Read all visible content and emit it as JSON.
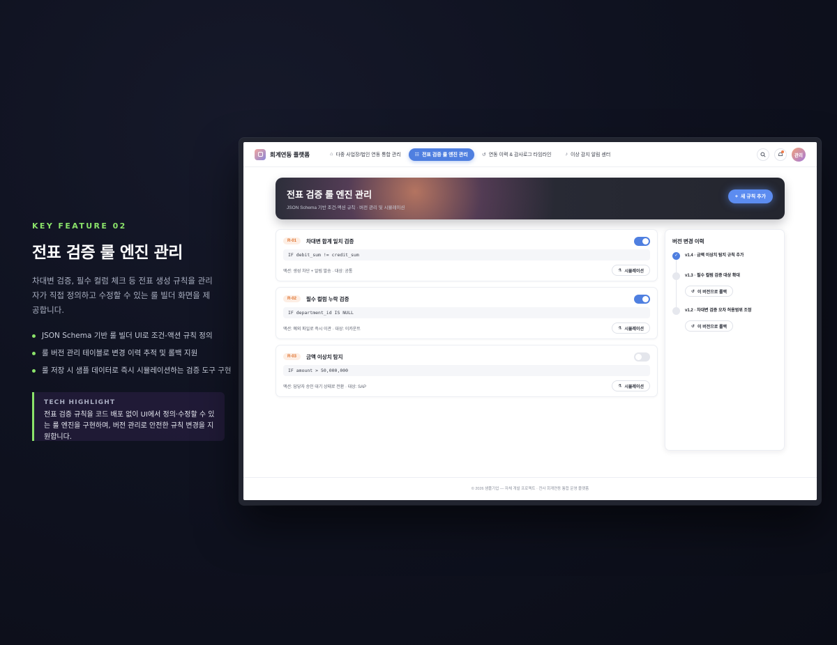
{
  "feature": {
    "kicker": "KEY FEATURE 02",
    "title": "전표 검증 룰 엔진 관리",
    "description": "차대변 검증, 필수 컬럼 체크 등 전표 생성 규칙을 관리자가 직접 정의하고 수정할 수 있는 룰 빌더 화면을 제공합니다.",
    "bullets": [
      "JSON Schema 기반 룰 빌더 UI로 조건-액션 규칙 정의",
      "룰 버전 관리 테이블로 변경 이력 추적 및 롤백 지원",
      "룰 저장 시 샘플 데이터로 즉시 시뮬레이션하는 검증 도구 구현"
    ],
    "highlight_label": "TECH HIGHLIGHT",
    "highlight_text": "전표 검증 규칙을 코드 배포 없이 UI에서 정의·수정할 수 있는 룰 엔진을 구현하며, 버전 관리로 안전한 규칙 변경을 지원합니다."
  },
  "app": {
    "brand": "회계연동 플랫폼",
    "nav": [
      {
        "label": "다중 사업장/법인 연동 통합 관리",
        "icon": "building-icon",
        "glyph": "🏛"
      },
      {
        "label": "전표 검증 룰 엔진 관리",
        "icon": "list-icon",
        "glyph": "☷"
      },
      {
        "label": "연동 이력 & 감사로그 타임라인",
        "icon": "history-icon",
        "glyph": "↺"
      },
      {
        "label": "이상 감지 알림 센터",
        "icon": "bell-icon",
        "glyph": "🔔"
      }
    ],
    "avatar": "관리"
  },
  "hero": {
    "title": "전표 검증 룰 엔진 관리",
    "subtitle": "JSON Schema 기반 조건-액션 규칙 · 버전 관리 및 시뮬레이션",
    "add_button": "새 규칙 추가"
  },
  "rules": [
    {
      "id": "R-01",
      "name": "차대변 합계 일치 검증",
      "code": "IF debit_sum != credit_sum",
      "meta": "액션: 생성 차단 + 알림 발송 · 대상: 공통",
      "enabled": true,
      "sim": "시뮬레이션"
    },
    {
      "id": "R-02",
      "name": "필수 컬럼 누락 검증",
      "code": "IF department_id IS NULL",
      "meta": "액션: 예외 파일로 즉시 이관 · 대상: 이카운트",
      "enabled": true,
      "sim": "시뮬레이션"
    },
    {
      "id": "R-03",
      "name": "금액 이상치 탐지",
      "code": "IF amount > 50,000,000",
      "meta": "액션: 담당자 승인 대기 상태로 전환 · 대상: SAP",
      "enabled": false,
      "sim": "시뮬레이션"
    }
  ],
  "history": {
    "title": "버전 변경 이력",
    "items": [
      {
        "label": "v1.4 · 금액 이상치 탐지 규칙 추가",
        "current": true
      },
      {
        "label": "v1.3 · 필수 컬럼 검증 대상 확대",
        "rollback": "이 버전으로 롤백"
      },
      {
        "label": "v1.2 · 차대변 검증 오차 허용범위 조정",
        "rollback": "이 버전으로 롤백"
      }
    ]
  },
  "footer": "© 2026 샘플기업 — 자체 개발 프로젝트 · 전사 회계연동 통합 운영 플랫폼",
  "colors": {
    "accent": "#4f7fe0",
    "feature_green": "#8be36a",
    "rule_id": "#e0722e"
  }
}
